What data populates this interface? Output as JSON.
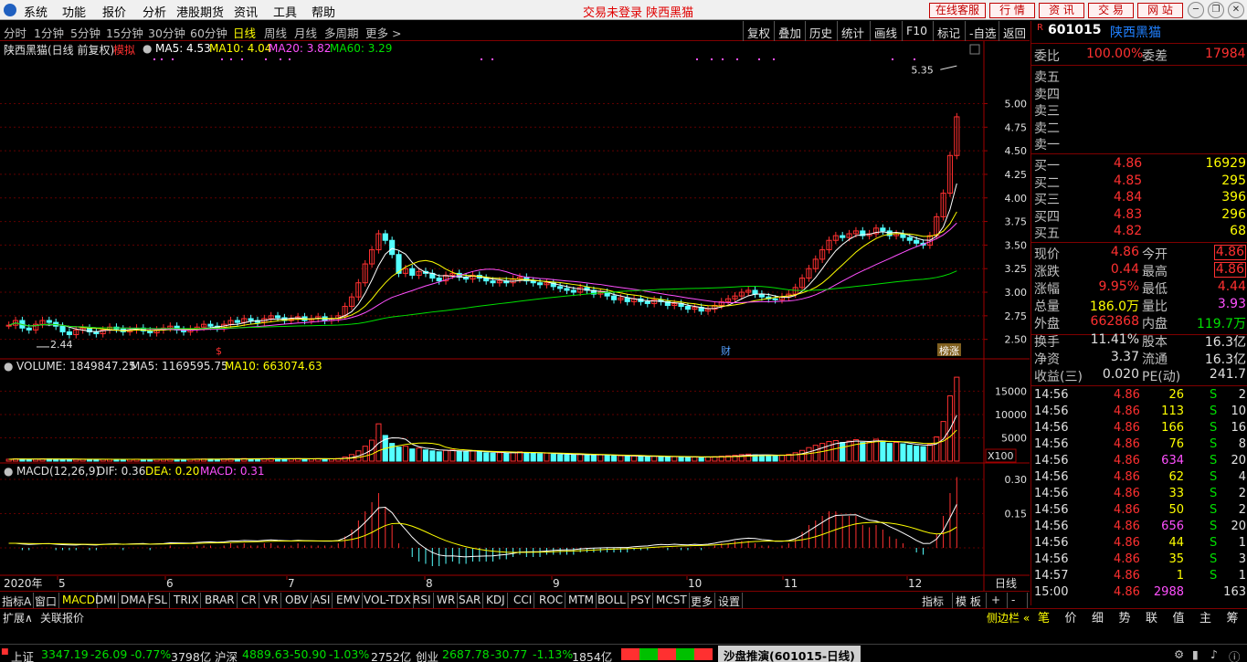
{
  "menu": {
    "items": [
      "系统",
      "功能",
      "报价",
      "分析",
      "港股期货",
      "资讯",
      "工具",
      "帮助"
    ],
    "center_text": "交易未登录  陕西黑猫",
    "top_buttons": [
      "在线客服",
      "行  情",
      "资  讯",
      "交  易",
      "网  站"
    ]
  },
  "period_bar": {
    "items": [
      "分时",
      "1分钟",
      "5分钟",
      "15分钟",
      "30分钟",
      "60分钟",
      "日线",
      "周线",
      "月线",
      "多周期",
      "更多 >"
    ],
    "active": "日线",
    "tools": [
      "复权",
      "叠加",
      "历史",
      "统计",
      "画线",
      "F10",
      "标记",
      "-自选",
      "返回"
    ]
  },
  "chart_header": {
    "stock": "陕西黑猫(日线 前复权)",
    "mode": "模拟",
    "ma5": "MA5: 4.53",
    "ma10": "MA10: 4.04",
    "ma20": "MA20: 3.82",
    "ma60": "MA60: 3.29"
  },
  "volume_header": {
    "vol": "VOLUME: 1849847.25",
    "ma5": "MA5: 1169595.75",
    "ma10": "MA10: 663074.63"
  },
  "macd_header": {
    "name": "MACD(12,26,9)",
    "dif": "DIF: 0.36",
    "dea": "DEA: 0.20",
    "macd": "MACD: 0.31"
  },
  "chart_labels": {
    "high_label": "5.35",
    "low_label": "2.44",
    "marker_s": "$",
    "marker_cai": "财",
    "marker_bang": "榜涨",
    "x100": "X100",
    "year_label": "2020年",
    "timeframe": "日线"
  },
  "chart_data": {
    "type": "candlestick",
    "price_axis_ticks": [
      "5.00",
      "4.75",
      "4.50",
      "4.25",
      "4.00",
      "3.75",
      "3.50",
      "3.25",
      "3.00",
      "2.75",
      "2.50"
    ],
    "volume_axis_ticks": [
      "15000",
      "10000",
      "5000"
    ],
    "macd_axis_ticks": [
      "0.30",
      "0.15"
    ],
    "month_labels": [
      "5",
      "6",
      "7",
      "8",
      "9",
      "10",
      "11",
      "12"
    ],
    "ylim": [
      2.4,
      5.45
    ],
    "close_series": [
      2.65,
      2.7,
      2.62,
      2.6,
      2.66,
      2.7,
      2.68,
      2.64,
      2.58,
      2.55,
      2.6,
      2.62,
      2.58,
      2.56,
      2.6,
      2.63,
      2.61,
      2.58,
      2.6,
      2.62,
      2.59,
      2.57,
      2.6,
      2.62,
      2.64,
      2.6,
      2.58,
      2.61,
      2.63,
      2.66,
      2.64,
      2.62,
      2.66,
      2.7,
      2.68,
      2.72,
      2.7,
      2.68,
      2.72,
      2.75,
      2.73,
      2.7,
      2.72,
      2.74,
      2.7,
      2.72,
      2.74,
      2.7,
      2.72,
      2.75,
      2.85,
      2.95,
      3.1,
      3.3,
      3.45,
      3.62,
      3.55,
      3.4,
      3.2,
      3.25,
      3.18,
      3.22,
      3.2,
      3.15,
      3.12,
      3.18,
      3.2,
      3.16,
      3.14,
      3.18,
      3.15,
      3.12,
      3.1,
      3.12,
      3.1,
      3.14,
      3.16,
      3.12,
      3.1,
      3.08,
      3.1,
      3.06,
      3.04,
      3.02,
      3.0,
      3.05,
      3.02,
      2.98,
      3.0,
      2.96,
      2.92,
      2.94,
      2.9,
      2.93,
      2.9,
      2.88,
      2.92,
      2.9,
      2.86,
      2.88,
      2.85,
      2.82,
      2.84,
      2.8,
      2.82,
      2.86,
      2.9,
      2.93,
      2.96,
      3.0,
      3.02,
      2.98,
      2.95,
      2.93,
      2.92,
      2.95,
      2.98,
      3.05,
      3.15,
      3.25,
      3.35,
      3.45,
      3.55,
      3.6,
      3.58,
      3.62,
      3.65,
      3.6,
      3.62,
      3.68,
      3.65,
      3.6,
      3.62,
      3.58,
      3.55,
      3.52,
      3.5,
      3.6,
      3.8,
      4.05,
      4.45,
      4.86
    ],
    "volume_series": [
      400,
      500,
      450,
      380,
      420,
      500,
      480,
      430,
      390,
      360,
      380,
      420,
      400,
      370,
      390,
      410,
      400,
      380,
      390,
      410,
      380,
      370,
      390,
      400,
      420,
      400,
      380,
      400,
      420,
      450,
      430,
      400,
      450,
      520,
      480,
      550,
      500,
      460,
      520,
      560,
      530,
      480,
      500,
      540,
      480,
      500,
      520,
      480,
      500,
      560,
      900,
      1400,
      2200,
      3200,
      4500,
      8000,
      5500,
      3800,
      3000,
      3200,
      2600,
      2800,
      2400,
      2200,
      2000,
      2300,
      2400,
      2100,
      2000,
      2200,
      2000,
      1800,
      1700,
      1800,
      1700,
      1900,
      2000,
      1800,
      1700,
      1600,
      1700,
      1500,
      1400,
      1350,
      1300,
      1500,
      1400,
      1300,
      1350,
      1200,
      1100,
      1150,
      1050,
      1100,
      1000,
      950,
      1050,
      1000,
      900,
      950,
      880,
      850,
      900,
      850,
      880,
      950,
      1050,
      1150,
      1250,
      1400,
      1500,
      1350,
      1250,
      1200,
      1150,
      1300,
      1450,
      1800,
      2300,
      2900,
      3400,
      3800,
      4200,
      4400,
      4000,
      4300,
      4600,
      4000,
      4100,
      4700,
      4300,
      3800,
      4000,
      3700,
      3400,
      3200,
      3100,
      3600,
      5200,
      8500,
      14000,
      18000
    ],
    "macd_series": [
      0.0,
      0.0,
      -0.01,
      -0.01,
      0.0,
      0.0,
      0.0,
      -0.01,
      -0.01,
      -0.01,
      -0.01,
      0.0,
      -0.01,
      -0.01,
      0.0,
      0.0,
      0.0,
      -0.01,
      0.0,
      0.0,
      0.0,
      -0.01,
      0.0,
      0.0,
      0.01,
      0.0,
      0.0,
      0.0,
      0.01,
      0.01,
      0.01,
      0.0,
      0.01,
      0.02,
      0.01,
      0.02,
      0.01,
      0.01,
      0.02,
      0.02,
      0.01,
      0.01,
      0.01,
      0.02,
      0.01,
      0.01,
      0.01,
      0.01,
      0.01,
      0.02,
      0.05,
      0.08,
      0.12,
      0.16,
      0.2,
      0.24,
      0.18,
      0.1,
      0.02,
      0.0,
      -0.04,
      -0.06,
      -0.07,
      -0.08,
      -0.08,
      -0.07,
      -0.06,
      -0.07,
      -0.07,
      -0.06,
      -0.06,
      -0.06,
      -0.06,
      -0.05,
      -0.05,
      -0.04,
      -0.03,
      -0.04,
      -0.04,
      -0.04,
      -0.03,
      -0.03,
      -0.03,
      -0.03,
      -0.03,
      -0.02,
      -0.02,
      -0.02,
      -0.02,
      -0.02,
      -0.02,
      -0.02,
      -0.02,
      -0.01,
      -0.01,
      -0.01,
      0.0,
      0.0,
      -0.01,
      0.0,
      -0.01,
      -0.01,
      0.0,
      -0.01,
      0.0,
      0.01,
      0.02,
      0.02,
      0.03,
      0.03,
      0.03,
      0.02,
      0.01,
      0.01,
      0.0,
      0.01,
      0.02,
      0.04,
      0.07,
      0.1,
      0.12,
      0.14,
      0.16,
      0.16,
      0.14,
      0.14,
      0.14,
      0.1,
      0.09,
      0.1,
      0.08,
      0.05,
      0.04,
      0.02,
      0.0,
      -0.02,
      -0.03,
      0.0,
      0.06,
      0.14,
      0.24,
      0.31
    ]
  },
  "quote": {
    "code": "601015",
    "name": "陕西黑猫",
    "weibi_label": "委比",
    "weibi_value": "100.00%",
    "weicha_label": "委差",
    "weicha_value": "17984",
    "sell": [
      {
        "label": "卖五",
        "price": "",
        "vol": ""
      },
      {
        "label": "卖四",
        "price": "",
        "vol": ""
      },
      {
        "label": "卖三",
        "price": "",
        "vol": ""
      },
      {
        "label": "卖二",
        "price": "",
        "vol": ""
      },
      {
        "label": "卖一",
        "price": "",
        "vol": ""
      }
    ],
    "buy": [
      {
        "label": "买一",
        "price": "4.86",
        "vol": "16929"
      },
      {
        "label": "买二",
        "price": "4.85",
        "vol": "295"
      },
      {
        "label": "买三",
        "price": "4.84",
        "vol": "396"
      },
      {
        "label": "买四",
        "price": "4.83",
        "vol": "296"
      },
      {
        "label": "买五",
        "price": "4.82",
        "vol": "68"
      }
    ],
    "stats": [
      {
        "l1": "现价",
        "v1": "4.86",
        "l2": "今开",
        "v2": "4.86",
        "c1": "#ff3030",
        "c2": "#ff3030",
        "box2": true
      },
      {
        "l1": "涨跌",
        "v1": "0.44",
        "l2": "最高",
        "v2": "4.86",
        "c1": "#ff3030",
        "c2": "#ff3030",
        "box2": true
      },
      {
        "l1": "涨幅",
        "v1": "9.95%",
        "l2": "最低",
        "v2": "4.44",
        "c1": "#ff3030",
        "c2": "#ff3030",
        "box2": false
      },
      {
        "l1": "总量",
        "v1": "186.0万",
        "l2": "量比",
        "v2": "3.93",
        "c1": "#ffff00",
        "c2": "#ff50ff",
        "box2": false
      },
      {
        "l1": "外盘",
        "v1": "662868",
        "l2": "内盘",
        "v2": "119.7万",
        "c1": "#ff3030",
        "c2": "#00e000",
        "box2": false
      }
    ],
    "stats2": [
      {
        "l1": "换手",
        "v1": "11.41%",
        "l2": "股本",
        "v2": "16.3亿"
      },
      {
        "l1": "净资",
        "v1": "3.37",
        "l2": "流通",
        "v2": "16.3亿"
      },
      {
        "l1": "收益(三)",
        "v1": "0.020",
        "l2": "PE(动)",
        "v2": "241.7"
      }
    ],
    "ticks": [
      {
        "time": "14:56",
        "price": "4.86",
        "vol": "26",
        "side": "S",
        "n": "2",
        "vcolor": "#ffff00"
      },
      {
        "time": "14:56",
        "price": "4.86",
        "vol": "113",
        "side": "S",
        "n": "10",
        "vcolor": "#ffff00"
      },
      {
        "time": "14:56",
        "price": "4.86",
        "vol": "166",
        "side": "S",
        "n": "16",
        "vcolor": "#ffff00"
      },
      {
        "time": "14:56",
        "price": "4.86",
        "vol": "76",
        "side": "S",
        "n": "8",
        "vcolor": "#ffff00"
      },
      {
        "time": "14:56",
        "price": "4.86",
        "vol": "634",
        "side": "S",
        "n": "20",
        "vcolor": "#ff50ff"
      },
      {
        "time": "14:56",
        "price": "4.86",
        "vol": "62",
        "side": "S",
        "n": "4",
        "vcolor": "#ffff00"
      },
      {
        "time": "14:56",
        "price": "4.86",
        "vol": "33",
        "side": "S",
        "n": "2",
        "vcolor": "#ffff00"
      },
      {
        "time": "14:56",
        "price": "4.86",
        "vol": "50",
        "side": "S",
        "n": "2",
        "vcolor": "#ffff00"
      },
      {
        "time": "14:56",
        "price": "4.86",
        "vol": "656",
        "side": "S",
        "n": "20",
        "vcolor": "#ff50ff"
      },
      {
        "time": "14:56",
        "price": "4.86",
        "vol": "44",
        "side": "S",
        "n": "1",
        "vcolor": "#ffff00"
      },
      {
        "time": "14:56",
        "price": "4.86",
        "vol": "35",
        "side": "S",
        "n": "3",
        "vcolor": "#ffff00"
      },
      {
        "time": "14:57",
        "price": "4.86",
        "vol": "1",
        "side": "S",
        "n": "1",
        "vcolor": "#ffff00"
      },
      {
        "time": "15:00",
        "price": "4.86",
        "vol": "2988",
        "side": "",
        "n": "163",
        "vcolor": "#ff50ff"
      }
    ]
  },
  "indicator_tabs": {
    "items": [
      "指标A",
      "窗口",
      "MACD",
      "DMI",
      "DMA",
      "FSL",
      "TRIX",
      "BRAR",
      "CR",
      "VR",
      "OBV",
      "ASI",
      "EMV",
      "VOL-TDX",
      "RSI",
      "WR",
      "SAR",
      "KDJ",
      "CCI",
      "ROC",
      "MTM",
      "BOLL",
      "PSY",
      "MCST",
      "更多",
      "设置"
    ],
    "active": "MACD",
    "right": [
      "指标B",
      "模 板",
      "+",
      "-"
    ]
  },
  "bottom": {
    "expand": "扩展∧",
    "related": "关联报价",
    "side_toggle": "侧边栏 «",
    "side_tabs": [
      "笔",
      "价",
      "细",
      "势",
      "联",
      "值",
      "主",
      "筹"
    ]
  },
  "status": {
    "sh_label": "上证",
    "sh_val": "3347.19",
    "sh_chg": "-26.09",
    "sh_pct": "-0.77%",
    "sh_amt": "3798亿",
    "sz_label": "沪深",
    "sz_val": "4889.63",
    "sz_chg": "-50.90",
    "sz_pct": "-1.03%",
    "sz_amt": "2752亿",
    "cy_label": "创业",
    "cy_val": "2687.78",
    "cy_chg": "-30.77",
    "cy_pct": "-1.13%",
    "cy_amt": "1854亿",
    "push": "沙盘推演(601015-日线)"
  }
}
